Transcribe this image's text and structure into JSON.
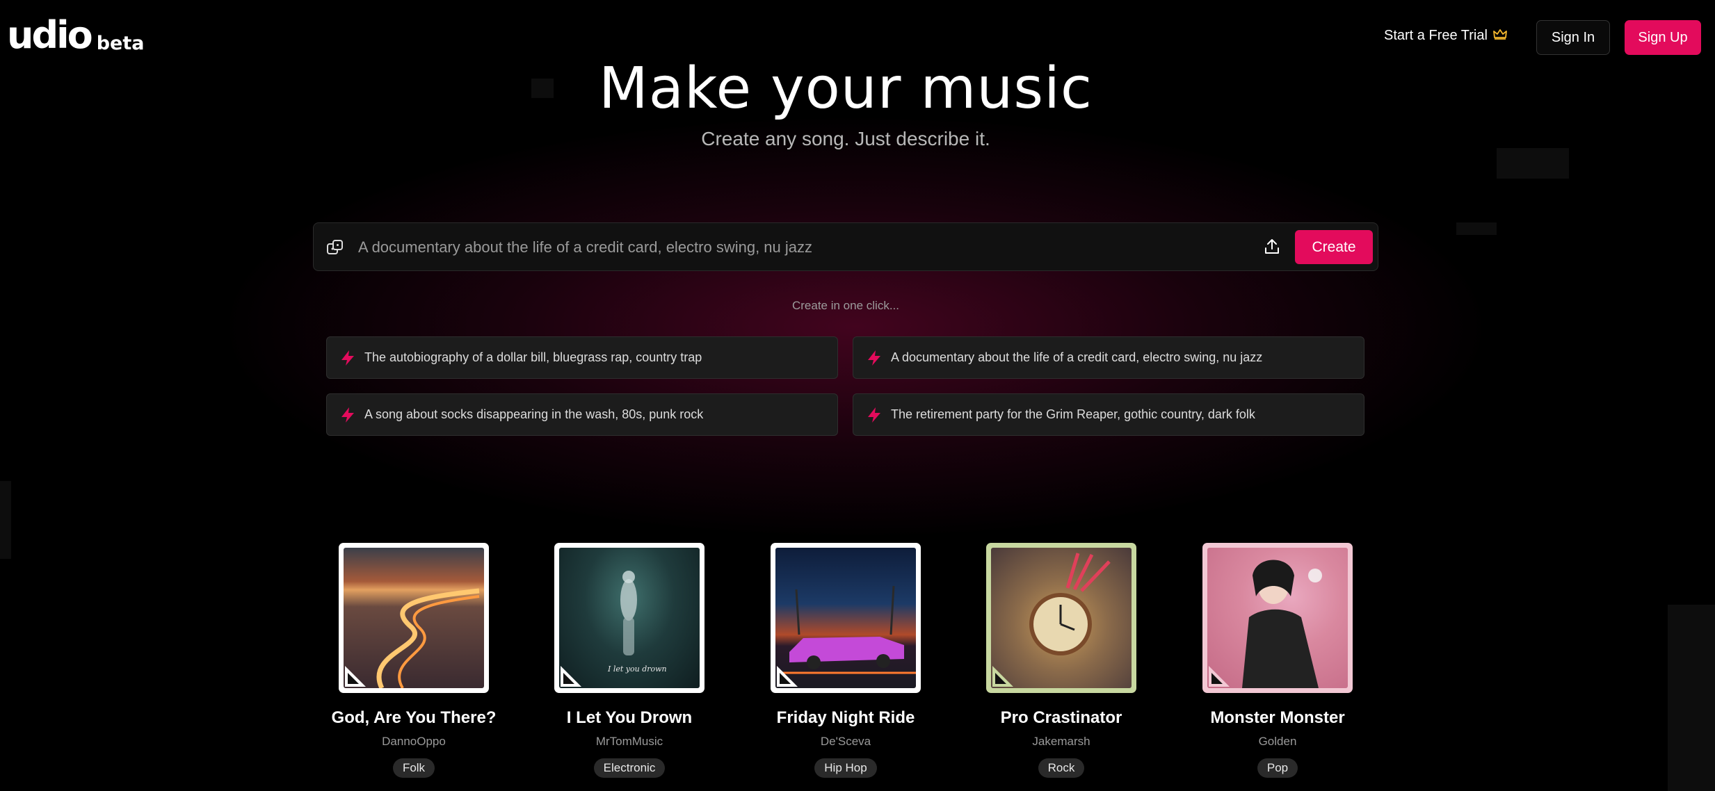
{
  "brand": {
    "logo": "udio",
    "badge": "beta"
  },
  "header": {
    "trial_label": "Start a Free Trial",
    "signin_label": "Sign In",
    "signup_label": "Sign Up"
  },
  "hero": {
    "title": "Make your music",
    "subtitle": "Create any song. Just describe it."
  },
  "prompt": {
    "placeholder": "A documentary about the life of a credit card, electro swing, nu jazz",
    "create_label": "Create"
  },
  "one_click": {
    "label": "Create in one click...",
    "suggestions": [
      "The autobiography of a dollar bill, bluegrass rap, country trap",
      "A documentary about the life of a credit card, electro swing, nu jazz",
      "A song about socks disappearing in the wash, 80s, punk rock",
      "The retirement party for the Grim Reaper, gothic country, dark folk"
    ]
  },
  "songs": [
    {
      "title": "God, Are You There?",
      "artist": "DannoOppo",
      "genre": "Folk"
    },
    {
      "title": "I Let You Drown",
      "artist": "MrTomMusic",
      "genre": "Electronic",
      "art_caption": "I let you drown"
    },
    {
      "title": "Friday Night Ride",
      "artist": "De'Sceva",
      "genre": "Hip Hop"
    },
    {
      "title": "Pro Crastinator",
      "artist": "Jakemarsh",
      "genre": "Rock"
    },
    {
      "title": "Monster Monster",
      "artist": "Golden",
      "genre": "Pop"
    }
  ],
  "colors": {
    "accent": "#e30b5c",
    "background": "#000000",
    "card": "#1c1c1c"
  },
  "icons": [
    "crown-icon",
    "dice-icon",
    "upload-icon",
    "lightning-icon"
  ]
}
